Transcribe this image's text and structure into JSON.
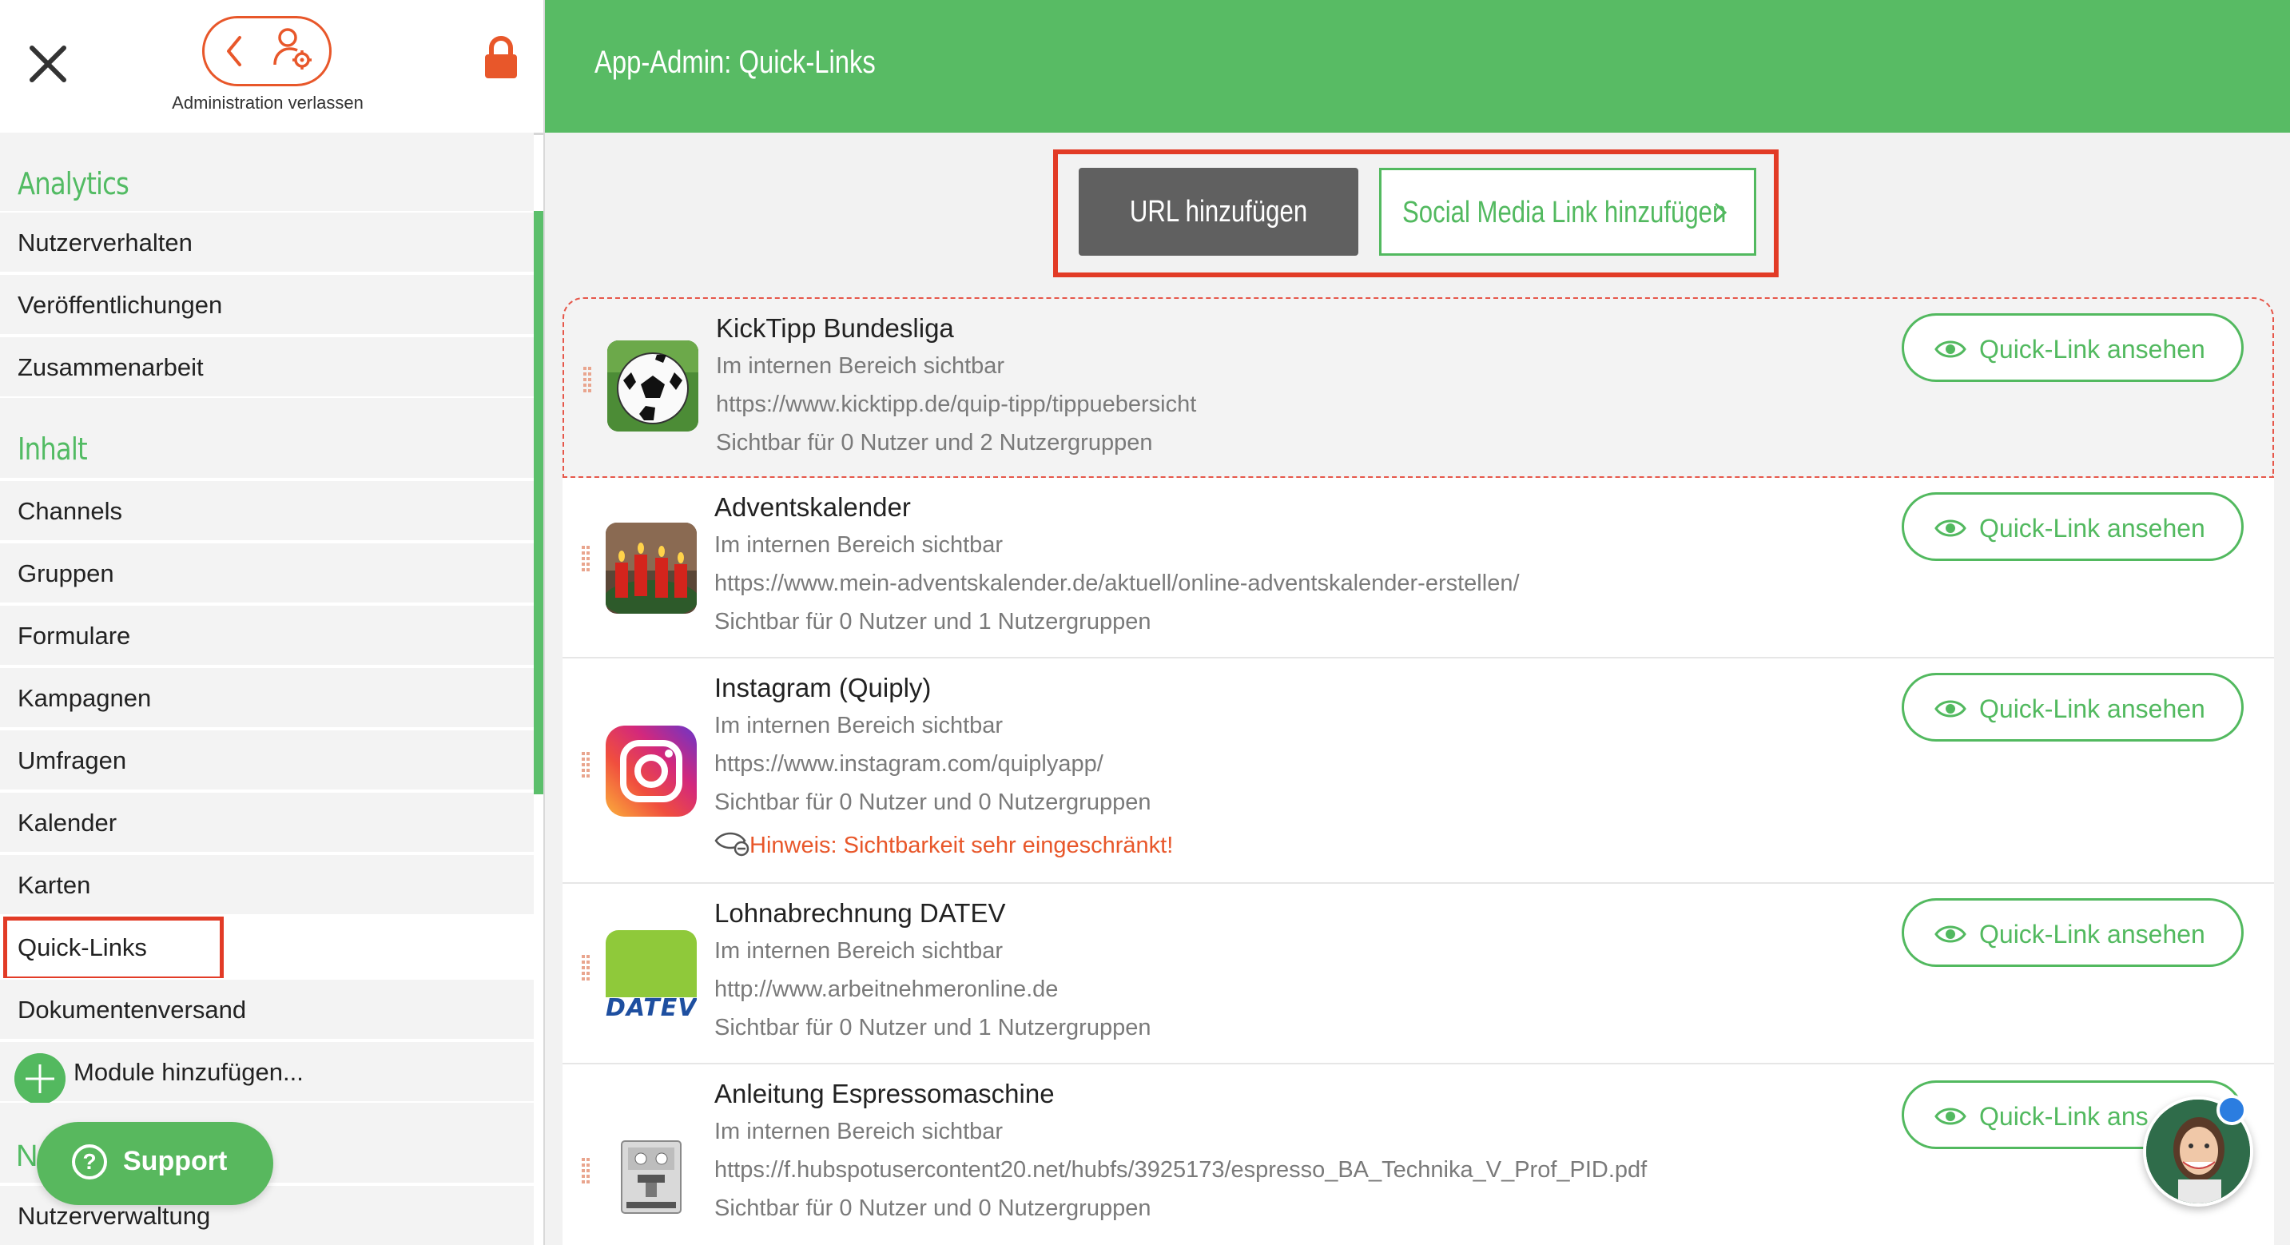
{
  "sidebar": {
    "leave_label": "Administration verlassen",
    "sections": [
      {
        "title": "Analytics"
      },
      {
        "title": "Inhalt"
      }
    ],
    "analytics_items": [
      "Nutzerverhalten",
      "Veröffentlichungen",
      "Zusammenarbeit"
    ],
    "content_items": [
      "Channels",
      "Gruppen",
      "Formulare",
      "Kampagnen",
      "Umfragen",
      "Kalender",
      "Karten",
      "Quick-Links",
      "Dokumentenversand",
      "Module hinzufügen..."
    ],
    "next_section_partial": "N",
    "last_item": "Nutzerverwaltung",
    "active_item": "Quick-Links"
  },
  "support": {
    "label": "Support"
  },
  "header": {
    "title": "App-Admin: Quick-Links"
  },
  "actions": {
    "add_url": "URL hinzufügen",
    "add_social": "Social Media Link hinzufügen"
  },
  "quicklinks": [
    {
      "title": "KickTipp Bundesliga",
      "area": "Im internen Bereich sichtbar",
      "url": "https://www.kicktipp.de/quip-tipp/tippuebersicht",
      "visibility": "Sichtbar für 0 Nutzer und 2 Nutzergruppen",
      "button": "Quick-Link ansehen",
      "icon": "soccer-ball"
    },
    {
      "title": "Adventskalender",
      "area": "Im internen Bereich sichtbar",
      "url": "https://www.mein-adventskalender.de/aktuell/online-adventskalender-erstellen/",
      "visibility": "Sichtbar für 0 Nutzer und 1 Nutzergruppen",
      "button": "Quick-Link ansehen",
      "icon": "advent-candles"
    },
    {
      "title": "Instagram (Quiply)",
      "area": "Im internen Bereich sichtbar",
      "url": "https://www.instagram.com/quiplyapp/",
      "visibility": "Sichtbar für 0 Nutzer und 0 Nutzergruppen",
      "warning": "Hinweis: Sichtbarkeit sehr eingeschränkt!",
      "button": "Quick-Link ansehen",
      "icon": "instagram-logo"
    },
    {
      "title": "Lohnabrechnung DATEV",
      "area": "Im internen Bereich sichtbar",
      "url": "http://www.arbeitnehmeronline.de",
      "visibility": "Sichtbar für 0 Nutzer und 1 Nutzergruppen",
      "button": "Quick-Link ansehen",
      "icon": "datev-logo",
      "logo_text": "DATEV"
    },
    {
      "title": "Anleitung Espressomaschine",
      "area": "Im internen Bereich sichtbar",
      "url": "https://f.hubspotusercontent20.net/hubfs/3925173/espresso_BA_Technika_V_Prof_PID.pdf",
      "visibility": "Sichtbar für 0 Nutzer und 0 Nutzergruppen",
      "button": "Quick-Link ans",
      "icon": "espresso-machine"
    }
  ],
  "colors": {
    "brand_green": "#58bb64",
    "accent_orange": "#e8572a",
    "highlight_red": "#e23b26"
  }
}
